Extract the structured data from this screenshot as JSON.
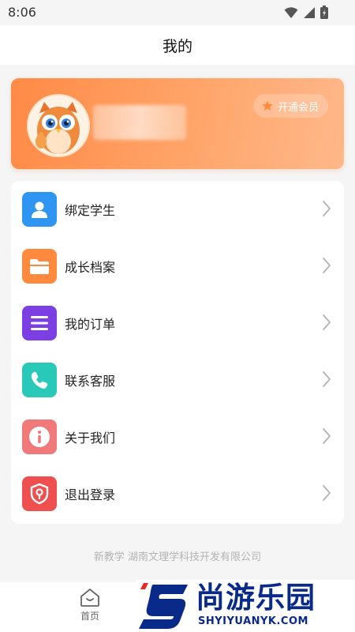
{
  "status_bar": {
    "time": "8:06"
  },
  "header": {
    "title": "我的"
  },
  "profile": {
    "vip_label": "开通会员"
  },
  "menu": {
    "items": [
      {
        "label": "绑定学生",
        "icon": "person-icon",
        "color": "#2f95f2"
      },
      {
        "label": "成长档案",
        "icon": "folder-icon",
        "color": "#ff8a3d"
      },
      {
        "label": "我的订单",
        "icon": "list-icon",
        "color": "#7b3fe4"
      },
      {
        "label": "联系客服",
        "icon": "phone-icon",
        "color": "#28c9b8"
      },
      {
        "label": "关于我们",
        "icon": "info-icon",
        "color": "#f07a7a"
      },
      {
        "label": "退出登录",
        "icon": "logout-shield-icon",
        "color": "#ef4f4f"
      }
    ]
  },
  "footer": {
    "text": "新教学 湖南文理学科技开发有限公司"
  },
  "bottom_nav": {
    "home_label": "首页"
  },
  "watermark": {
    "brand": "尚游乐园",
    "domain": "SHYIYUANYK.COM"
  },
  "colors": {
    "profile_gradient_start": "#ff8a46",
    "profile_gradient_end": "#ffb88a",
    "background": "#f5f5f5"
  }
}
